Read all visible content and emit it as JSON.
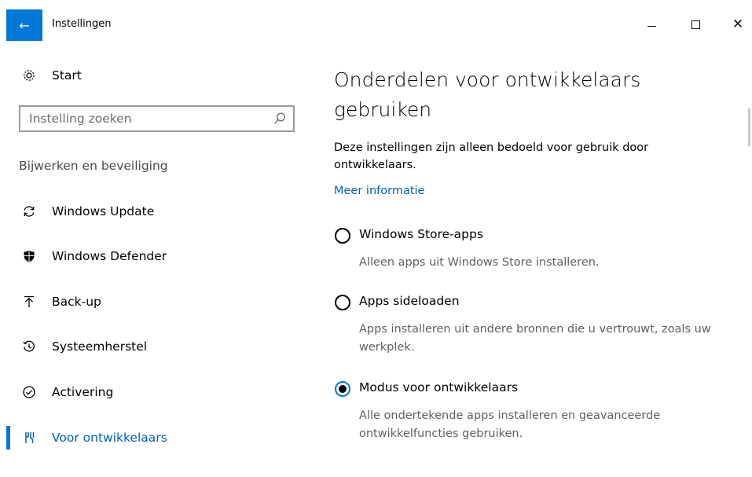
{
  "window": {
    "title": "Instellingen",
    "back_icon": "←"
  },
  "sidebar": {
    "home_label": "Start",
    "search_placeholder": "Instelling zoeken",
    "section_heading": "Bijwerken en beveiliging",
    "items": [
      {
        "label": "Windows Update",
        "icon": "refresh-icon"
      },
      {
        "label": "Windows Defender",
        "icon": "shield-icon"
      },
      {
        "label": "Back-up",
        "icon": "upload-arrow-icon"
      },
      {
        "label": "Systeemherstel",
        "icon": "history-icon"
      },
      {
        "label": "Activering",
        "icon": "checkmark-circle-icon"
      },
      {
        "label": "Voor ontwikkelaars",
        "icon": "developer-tools-icon",
        "selected": true
      }
    ]
  },
  "main": {
    "title": "Onderdelen voor ontwikkelaars gebruiken",
    "description": "Deze instellingen zijn alleen bedoeld voor gebruik door ontwikkelaars.",
    "link": "Meer informatie",
    "options": [
      {
        "label": "Windows Store-apps",
        "description": "Alleen apps uit Windows Store installeren.",
        "selected": false
      },
      {
        "label": "Apps sideloaden",
        "description": "Apps installeren uit andere bronnen die u vertrouwt, zoals uw werkplek.",
        "selected": false
      },
      {
        "label": "Modus voor ontwikkelaars",
        "description": "Alle ondertekende apps installeren en geavanceerde ontwikkelfuncties gebruiken.",
        "selected": true
      }
    ]
  },
  "colors": {
    "accent": "#0078d7",
    "link": "#0063b1",
    "secondary_text": "#5f5f5f"
  }
}
